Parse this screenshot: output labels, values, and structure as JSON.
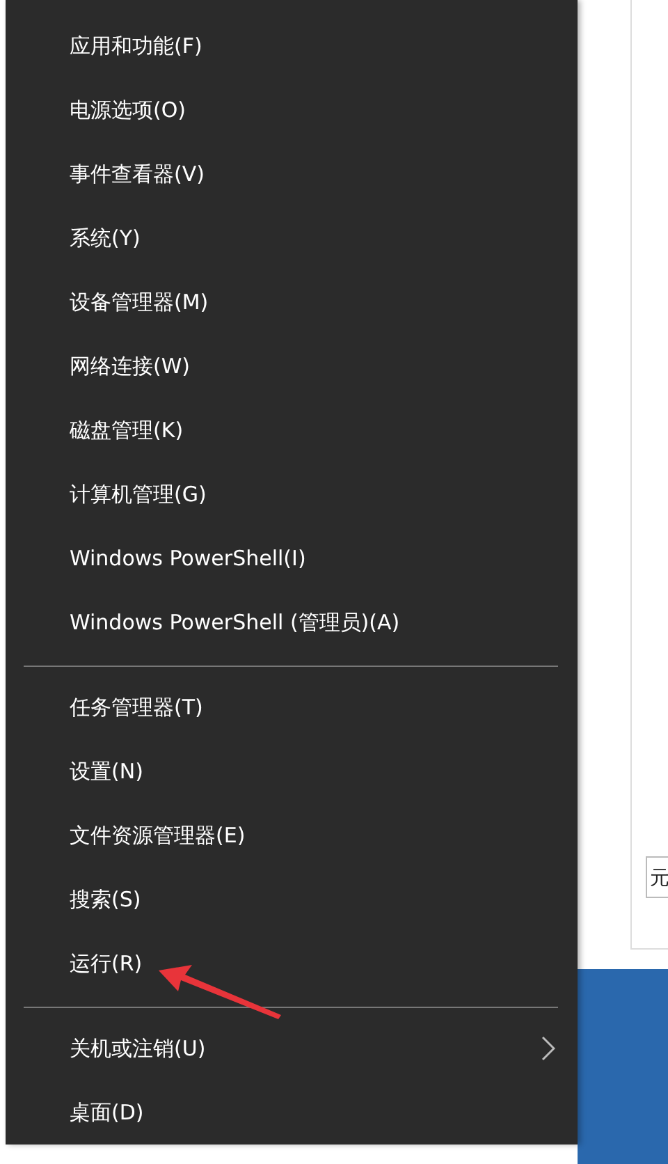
{
  "menu": {
    "groups": [
      {
        "items": [
          {
            "label": "应用和功能(F)",
            "kind": "plain"
          },
          {
            "label": "电源选项(O)",
            "kind": "plain"
          },
          {
            "label": "事件查看器(V)",
            "kind": "plain"
          },
          {
            "label": "系统(Y)",
            "kind": "plain"
          },
          {
            "label": "设备管理器(M)",
            "kind": "plain"
          },
          {
            "label": "网络连接(W)",
            "kind": "plain"
          },
          {
            "label": "磁盘管理(K)",
            "kind": "plain"
          },
          {
            "label": "计算机管理(G)",
            "kind": "plain"
          },
          {
            "label": "Windows PowerShell(I)",
            "kind": "plain"
          },
          {
            "label": "Windows PowerShell (管理员)(A)",
            "kind": "plain"
          }
        ]
      },
      {
        "items": [
          {
            "label": "任务管理器(T)",
            "kind": "plain"
          },
          {
            "label": "设置(N)",
            "kind": "plain"
          },
          {
            "label": "文件资源管理器(E)",
            "kind": "plain"
          },
          {
            "label": "搜索(S)",
            "kind": "plain"
          },
          {
            "label": "运行(R)",
            "kind": "plain"
          }
        ]
      },
      {
        "items": [
          {
            "label": "关机或注销(U)",
            "kind": "submenu"
          },
          {
            "label": "桌面(D)",
            "kind": "plain"
          }
        ]
      }
    ]
  },
  "background_window": {
    "field_text": "元"
  }
}
